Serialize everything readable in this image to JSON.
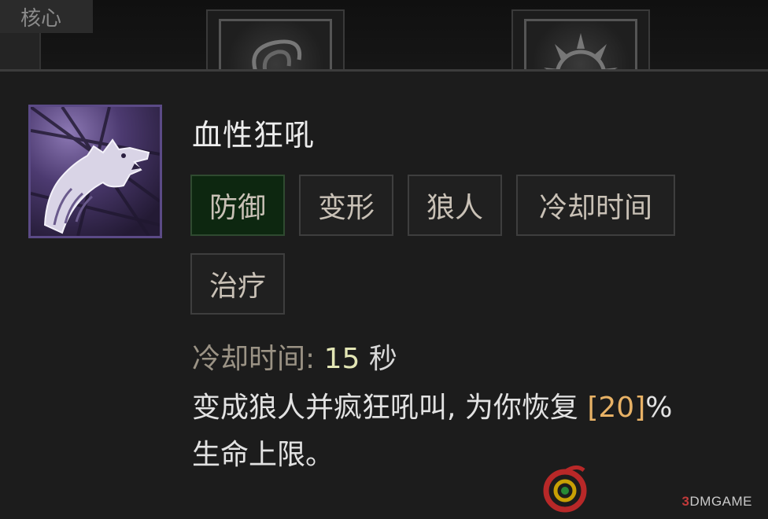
{
  "top_bar": {
    "section_label": "核心"
  },
  "skill": {
    "icon": "werewolf-howl-icon",
    "title": "血性狂吼",
    "tags": [
      {
        "label": "防御",
        "active": true
      },
      {
        "label": "变形",
        "active": false
      },
      {
        "label": "狼人",
        "active": false
      },
      {
        "label": "冷却时间",
        "active": false
      },
      {
        "label": "治疗",
        "active": false
      }
    ],
    "cooldown": {
      "label": "冷却时间:",
      "value": "15",
      "unit": "秒"
    },
    "description": {
      "line1_text": "变成狼人并疯狂吼叫, 为你恢复",
      "line1_value": "[20]",
      "line1_suffix": "%",
      "line2_text": "生命上限。"
    }
  },
  "watermark": {
    "brand_prefix": "3",
    "brand_rest": "DMGAME"
  },
  "colors": {
    "active_tag_bg": "#0d2710",
    "highlight_value": "#e8b266",
    "cooldown_value": "#e3e6b5",
    "icon_frame": "#5b4a86"
  }
}
